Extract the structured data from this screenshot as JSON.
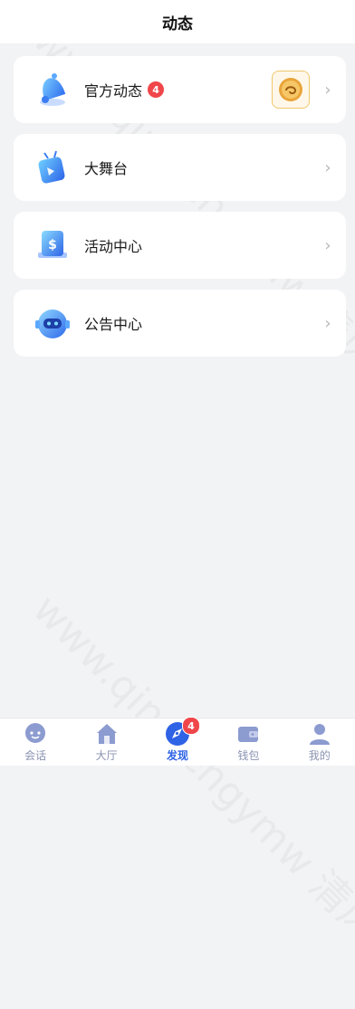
{
  "header": {
    "title": "动态"
  },
  "items": [
    {
      "label": "官方动态",
      "badge": "4",
      "icon": "bell-icon",
      "thumb": "coin-logo-icon"
    },
    {
      "label": "大舞台",
      "icon": "stage-icon"
    },
    {
      "label": "活动中心",
      "icon": "money-box-icon"
    },
    {
      "label": "公告中心",
      "icon": "robot-icon"
    }
  ],
  "tabbar": {
    "tabs": [
      {
        "label": "会话",
        "icon": "chat-icon"
      },
      {
        "label": "大厅",
        "icon": "home-icon"
      },
      {
        "label": "发现",
        "icon": "compass-icon",
        "badge": "4",
        "active": true
      },
      {
        "label": "钱包",
        "icon": "wallet-icon"
      },
      {
        "label": "我的",
        "icon": "user-icon"
      }
    ]
  },
  "colors": {
    "accent": "#2f63e6",
    "badge": "#f0464a",
    "background": "#f2f3f5"
  },
  "watermark": "www.qingfengymw 清风源码"
}
